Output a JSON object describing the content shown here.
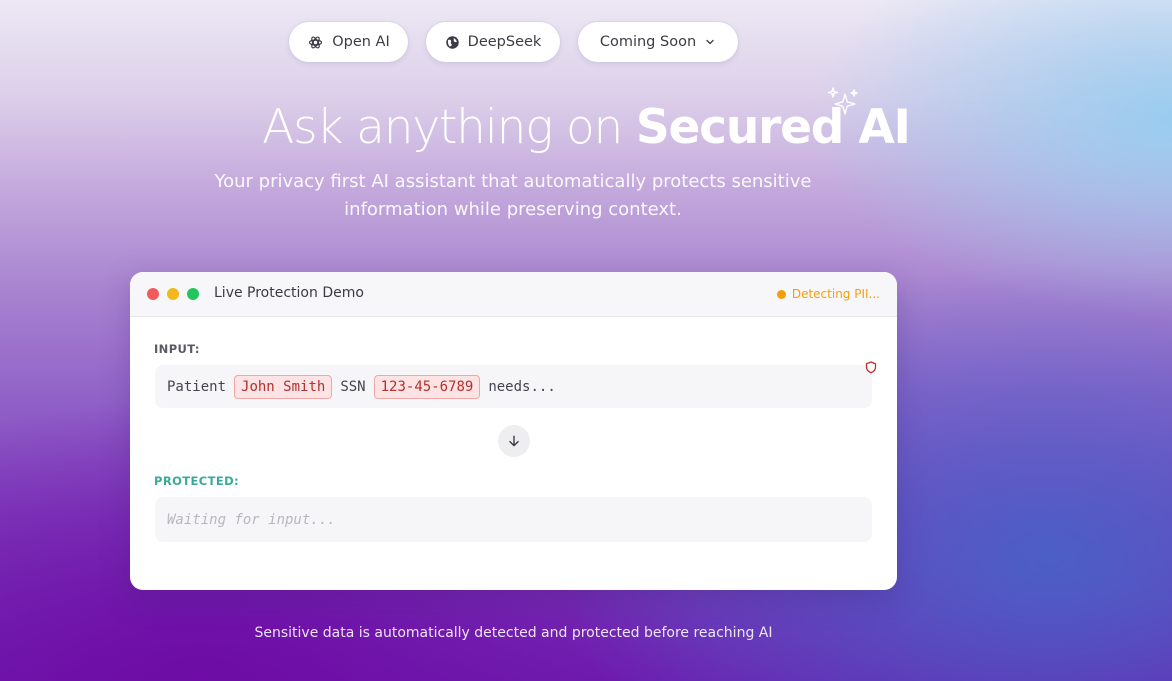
{
  "nav": {
    "openai": {
      "label": "Open AI",
      "icon": "openai-icon"
    },
    "deepseek": {
      "label": "DeepSeek",
      "icon": "globe-icon"
    },
    "coming_soon": {
      "label": "Coming Soon",
      "icon": "chevron-down-icon"
    }
  },
  "hero": {
    "title_part1": "Ask anything on ",
    "title_part2": "Secured AI",
    "subtitle": "Your privacy first AI assistant that automatically protects sensitive information while preserving context."
  },
  "demo": {
    "title": "Live Protection Demo",
    "status": "Detecting PII...",
    "status_color": "#f59e0b",
    "input_label": "INPUT:",
    "input_tokens": {
      "t1": "Patient",
      "pii1": "John Smith",
      "t2": "SSN",
      "pii2": "123-45-6789",
      "t3": "needs..."
    },
    "protected_label": "PROTECTED:",
    "protected_placeholder": "Waiting for input...",
    "accent_protected": "#3aa99a",
    "pii_color": "#b3302f"
  },
  "caption": "Sensitive data is automatically detected and protected before reaching AI"
}
